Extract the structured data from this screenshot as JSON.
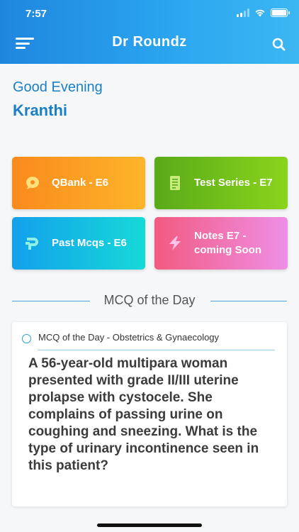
{
  "status_bar": {
    "time": "7:57"
  },
  "header": {
    "title": "Dr Roundz",
    "menu_icon": "hamburger-menu-icon",
    "search_icon": "search-icon",
    "bg_from": "#1f86de",
    "bg_to": "#3cb7f2"
  },
  "greeting": {
    "text": "Good Evening",
    "name": "Kranthi",
    "color": "#1a7fc6"
  },
  "tiles": [
    {
      "label": "QBank - E6",
      "icon": "chat-bubble-icon",
      "color_from": "#f98a1d",
      "color_to": "#fdb52a"
    },
    {
      "label": "Test Series - E7",
      "icon": "document-icon",
      "color_from": "#59aa19",
      "color_to": "#8ad41c"
    },
    {
      "label": "Past Mcqs - E6",
      "icon": "p-logo-icon",
      "color_from": "#13a0ec",
      "color_to": "#16d9d8"
    },
    {
      "label": "Notes E7 - coming Soon",
      "icon": "lightning-icon",
      "color_from": "#f25a80",
      "color_to": "#ef8fe6"
    }
  ],
  "mcq_section": {
    "title": "MCQ of the Day",
    "card_header": "MCQ of the Day - Obstetrics & Gynaecology",
    "question": "A 56-year-old multipara woman presented with grade II/III uterine prolapse with cystocele. She complains of passing urine on coughing and sneezing. What is the type of urinary incontinence seen in this patient?"
  }
}
